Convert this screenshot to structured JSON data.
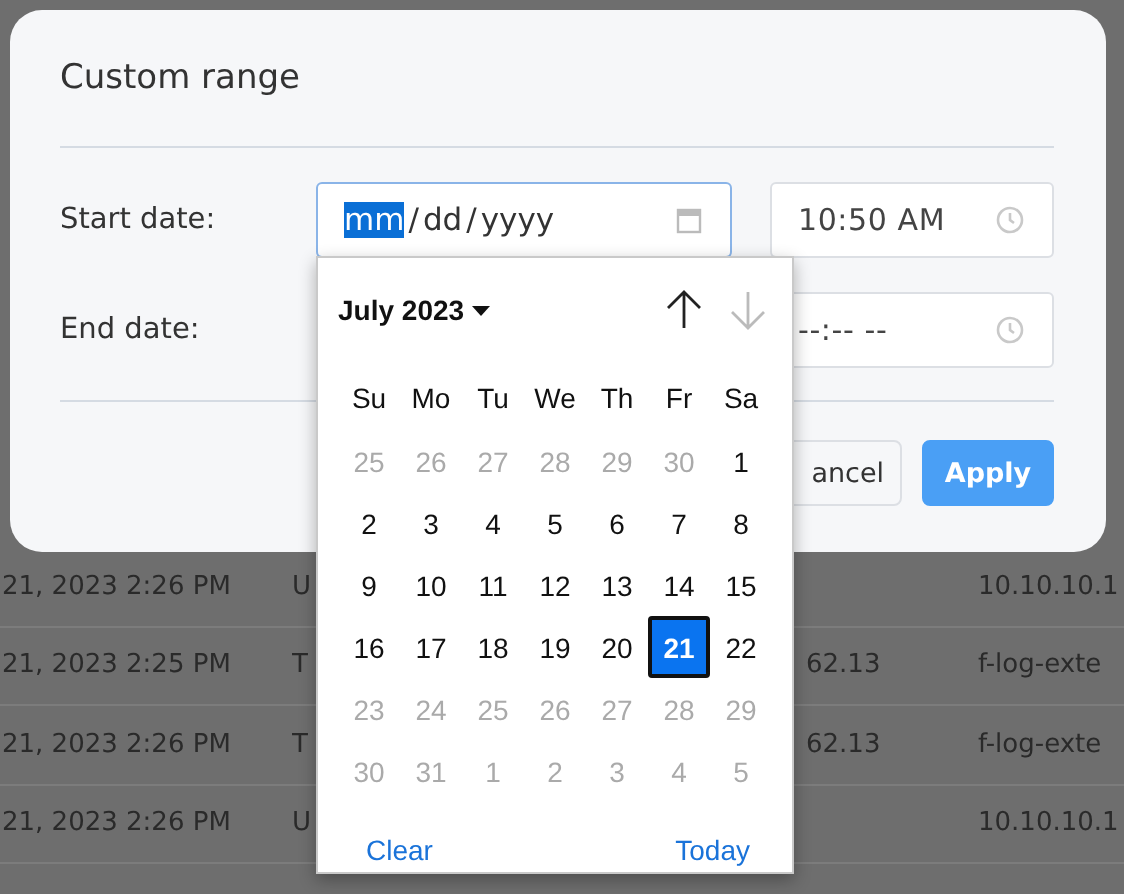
{
  "background_table": {
    "rows": [
      {
        "column_1": "21, 2023 2:26 PM",
        "column_2": "U",
        "column_3": "",
        "column_4": "10.10.10.1"
      },
      {
        "column_1": "21, 2023 2:25 PM",
        "column_2": "T",
        "column_3": "62.13",
        "column_4": "f-log-exte"
      },
      {
        "column_1": "21, 2023 2:26 PM",
        "column_2": "T",
        "column_3": "62.13",
        "column_4": "f-log-exte"
      },
      {
        "column_1": "21, 2023 2:26 PM",
        "column_2": "U",
        "column_3": "",
        "column_4": "10.10.10.1"
      }
    ]
  },
  "dialog": {
    "title": "Custom range",
    "start": {
      "label": "Start date:",
      "focused": true,
      "date_segments": [
        {
          "text": "mm",
          "selected": true
        },
        {
          "text": "/",
          "selected": false
        },
        {
          "text": "dd",
          "selected": false
        },
        {
          "text": "/",
          "selected": false
        },
        {
          "text": "yyyy",
          "selected": false
        }
      ],
      "time": "10:50 AM"
    },
    "end": {
      "label": "End date:",
      "time": "--:-- --"
    },
    "buttons": [
      {
        "label": "ancel",
        "kind": "secondary"
      },
      {
        "label": "Apply",
        "kind": "primary"
      }
    ]
  },
  "calendar": {
    "month": "July 2023",
    "up_disabled": false,
    "down_disabled": true,
    "weekdays": [
      "Su",
      "Mo",
      "Tu",
      "We",
      "Th",
      "Fr",
      "Sa"
    ],
    "weeks": [
      [
        {
          "day": "25",
          "outside": true,
          "selected": false
        },
        {
          "day": "26",
          "outside": true,
          "selected": false
        },
        {
          "day": "27",
          "outside": true,
          "selected": false
        },
        {
          "day": "28",
          "outside": true,
          "selected": false
        },
        {
          "day": "29",
          "outside": true,
          "selected": false
        },
        {
          "day": "30",
          "outside": true,
          "selected": false
        },
        {
          "day": "1",
          "outside": false,
          "selected": false
        }
      ],
      [
        {
          "day": "2",
          "outside": false,
          "selected": false
        },
        {
          "day": "3",
          "outside": false,
          "selected": false
        },
        {
          "day": "4",
          "outside": false,
          "selected": false
        },
        {
          "day": "5",
          "outside": false,
          "selected": false
        },
        {
          "day": "6",
          "outside": false,
          "selected": false
        },
        {
          "day": "7",
          "outside": false,
          "selected": false
        },
        {
          "day": "8",
          "outside": false,
          "selected": false
        }
      ],
      [
        {
          "day": "9",
          "outside": false,
          "selected": false
        },
        {
          "day": "10",
          "outside": false,
          "selected": false
        },
        {
          "day": "11",
          "outside": false,
          "selected": false
        },
        {
          "day": "12",
          "outside": false,
          "selected": false
        },
        {
          "day": "13",
          "outside": false,
          "selected": false
        },
        {
          "day": "14",
          "outside": false,
          "selected": false
        },
        {
          "day": "15",
          "outside": false,
          "selected": false
        }
      ],
      [
        {
          "day": "16",
          "outside": false,
          "selected": false
        },
        {
          "day": "17",
          "outside": false,
          "selected": false
        },
        {
          "day": "18",
          "outside": false,
          "selected": false
        },
        {
          "day": "19",
          "outside": false,
          "selected": false
        },
        {
          "day": "20",
          "outside": false,
          "selected": false
        },
        {
          "day": "21",
          "outside": false,
          "selected": true
        },
        {
          "day": "22",
          "outside": false,
          "selected": false
        }
      ],
      [
        {
          "day": "23",
          "outside": true,
          "selected": false
        },
        {
          "day": "24",
          "outside": true,
          "selected": false
        },
        {
          "day": "25",
          "outside": true,
          "selected": false
        },
        {
          "day": "26",
          "outside": true,
          "selected": false
        },
        {
          "day": "27",
          "outside": true,
          "selected": false
        },
        {
          "day": "28",
          "outside": true,
          "selected": false
        },
        {
          "day": "29",
          "outside": true,
          "selected": false
        }
      ],
      [
        {
          "day": "30",
          "outside": true,
          "selected": false
        },
        {
          "day": "31",
          "outside": true,
          "selected": false
        },
        {
          "day": "1",
          "outside": true,
          "selected": false
        },
        {
          "day": "2",
          "outside": true,
          "selected": false
        },
        {
          "day": "3",
          "outside": true,
          "selected": false
        },
        {
          "day": "4",
          "outside": true,
          "selected": false
        },
        {
          "day": "5",
          "outside": true,
          "selected": false
        }
      ]
    ],
    "footer": [
      "Clear",
      "Today"
    ]
  }
}
